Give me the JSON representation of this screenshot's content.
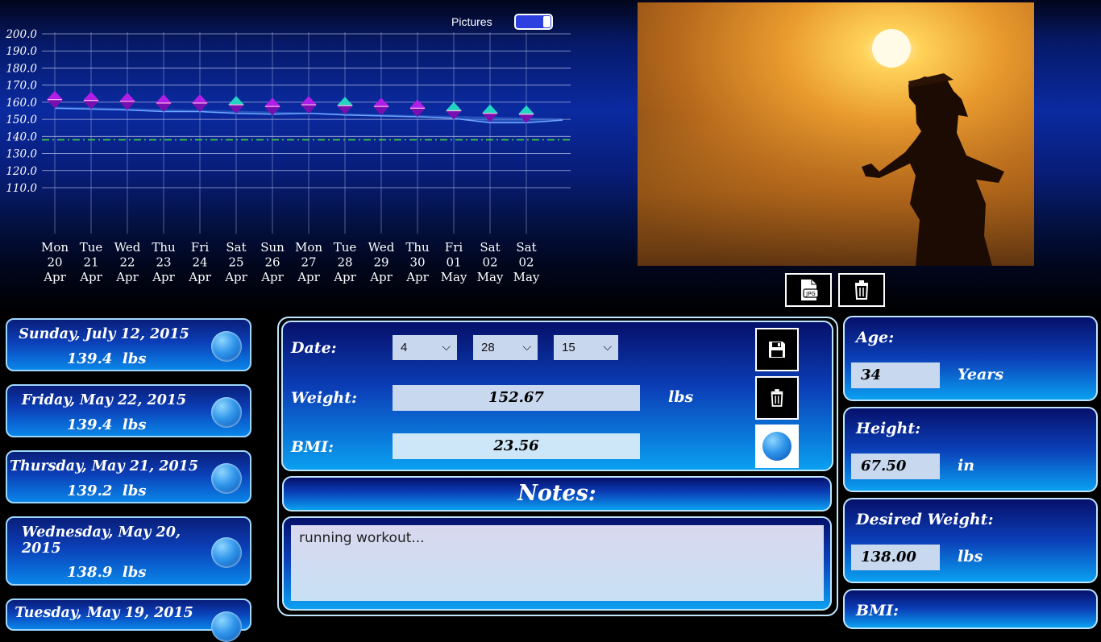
{
  "pictures_toggle": {
    "label": "Pictures",
    "on": true
  },
  "chart_data": {
    "type": "line",
    "y_ticks": [
      "200.0",
      "190.0",
      "180.0",
      "170.0",
      "160.0",
      "150.0",
      "140.0",
      "130.0",
      "120.0",
      "110.0"
    ],
    "ylim": [
      110,
      200
    ],
    "x_labels": [
      [
        "Mon",
        "20",
        "Apr"
      ],
      [
        "Tue",
        "21",
        "Apr"
      ],
      [
        "Wed",
        "22",
        "Apr"
      ],
      [
        "Thu",
        "23",
        "Apr"
      ],
      [
        "Fri",
        "24",
        "Apr"
      ],
      [
        "Sat",
        "25",
        "Apr"
      ],
      [
        "Sun",
        "26",
        "Apr"
      ],
      [
        "Mon",
        "27",
        "Apr"
      ],
      [
        "Tue",
        "28",
        "Apr"
      ],
      [
        "Wed",
        "29",
        "Apr"
      ],
      [
        "Thu",
        "30",
        "Apr"
      ],
      [
        "Fri",
        "01",
        "May"
      ],
      [
        "Sat",
        "02",
        "May"
      ],
      [
        "Sat",
        "02",
        "May"
      ]
    ],
    "series": [
      {
        "values": [
          161.5,
          161,
          160.5,
          159.5,
          159.5,
          158.5,
          157.5,
          158.5,
          158,
          157.5,
          156.5,
          155,
          153.5,
          153
        ]
      },
      {
        "values": [
          156.5,
          156,
          155.5,
          154.5,
          154.5,
          153.5,
          153,
          153.5,
          152.5,
          152,
          151.5,
          150.5,
          148,
          148,
          149.5
        ]
      }
    ],
    "marker_colors": [
      "purple",
      "purple",
      "purple",
      "purple",
      "purple",
      "teal",
      "purple",
      "purple",
      "teal",
      "purple",
      "purple",
      "teal",
      "teal",
      "teal"
    ],
    "goal_line": 138,
    "colors": {
      "purple": "#b01ee8",
      "teal": "#22d6c2",
      "goal": "#3cd03c",
      "line": "#6fa8ff"
    }
  },
  "entries": [
    {
      "date": "Sunday, July 12, 2015",
      "weight": "139.4",
      "unit": "lbs"
    },
    {
      "date": "Friday, May 22, 2015",
      "weight": "139.4",
      "unit": "lbs"
    },
    {
      "date": "Thursday, May 21, 2015",
      "weight": "139.2",
      "unit": "lbs"
    },
    {
      "date": "Wednesday, May 20, 2015",
      "weight": "138.9",
      "unit": "lbs"
    },
    {
      "date": "Tuesday, May 19, 2015",
      "weight": "",
      "unit": ""
    }
  ],
  "form": {
    "date_label": "Date:",
    "month": "4",
    "day": "28",
    "year": "15",
    "weight_label": "Weight:",
    "weight": "152.67",
    "weight_unit": "lbs",
    "bmi_label": "BMI:",
    "bmi": "23.56"
  },
  "notes": {
    "title": "Notes:",
    "text": "running workout..."
  },
  "profile": {
    "age_label": "Age:",
    "age": "34",
    "age_unit": "Years",
    "height_label": "Height:",
    "height": "67.50",
    "height_unit": "in",
    "desired_label": "Desired Weight:",
    "desired": "138.00",
    "desired_unit": "lbs",
    "bmi_label": "BMI:"
  },
  "icons": {
    "jpg": "jpg-file-icon",
    "trash": "trash-icon",
    "save": "save-icon",
    "mood": "smiley-face-icon"
  }
}
